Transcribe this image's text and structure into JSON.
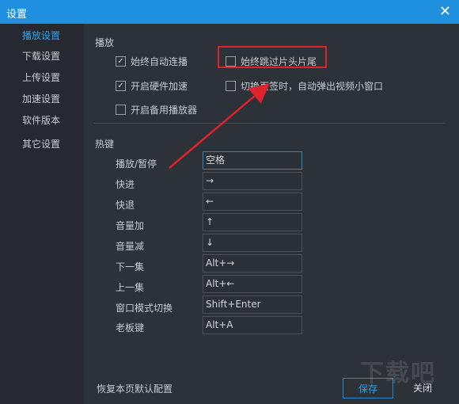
{
  "window": {
    "title": "设置"
  },
  "sidebar": {
    "items": [
      {
        "label": "播放设置",
        "active": true
      },
      {
        "label": "下载设置"
      },
      {
        "label": "上传设置"
      },
      {
        "label": "加速设置"
      },
      {
        "label": "软件版本"
      },
      {
        "label": "其它设置"
      }
    ]
  },
  "playback": {
    "title": "播放",
    "options": [
      {
        "label": "始终自动连播",
        "checked": true
      },
      {
        "label": "始终跳过片头片尾",
        "checked": false
      },
      {
        "label": "开启硬件加速",
        "checked": true
      },
      {
        "label": "切换页签时，自动弹出视频小窗口",
        "checked": false
      },
      {
        "label": "开启备用播放器",
        "checked": false
      }
    ]
  },
  "hotkeys": {
    "title": "热键",
    "rows": [
      {
        "label": "播放/暂停",
        "value": "空格"
      },
      {
        "label": "快进",
        "value": "→"
      },
      {
        "label": "快退",
        "value": "←"
      },
      {
        "label": "音量加",
        "value": "↑"
      },
      {
        "label": "音量减",
        "value": "↓"
      },
      {
        "label": "下一集",
        "value": "Alt+→"
      },
      {
        "label": "上一集",
        "value": "Alt+←"
      },
      {
        "label": "窗口模式切换",
        "value": "Shift+Enter"
      },
      {
        "label": "老板键",
        "value": "Alt+A"
      }
    ]
  },
  "footer": {
    "reset_label": "恢复本页默认配置",
    "save_label": "保存",
    "close_label": "关闭"
  },
  "watermark": "下载吧",
  "colors": {
    "accent": "#1f8fe0",
    "highlight": "#e0222a",
    "background": "#2b2f36"
  },
  "icons": {
    "close": "close-icon",
    "checkbox_checked": "check-icon"
  }
}
